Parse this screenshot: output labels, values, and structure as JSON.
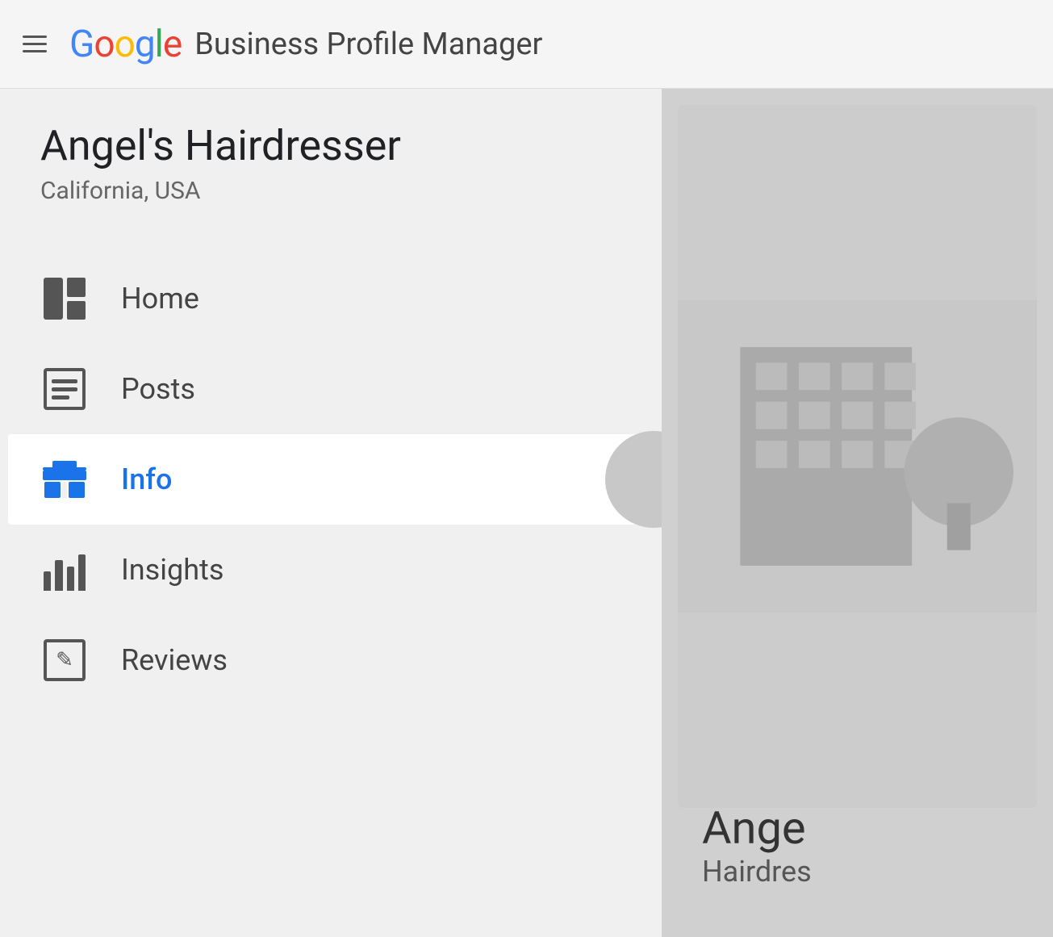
{
  "header": {
    "menu_label": "Menu",
    "google_letters": [
      "G",
      "o",
      "o",
      "g",
      "l",
      "e"
    ],
    "subtitle": "Business Profile Manager"
  },
  "sidebar": {
    "business_name": "Angel's Hairdresser",
    "business_location": "California, USA",
    "nav_items": [
      {
        "id": "home",
        "label": "Home",
        "icon": "home-icon",
        "active": false
      },
      {
        "id": "posts",
        "label": "Posts",
        "icon": "posts-icon",
        "active": false
      },
      {
        "id": "info",
        "label": "Info",
        "icon": "info-icon",
        "active": true
      },
      {
        "id": "insights",
        "label": "Insights",
        "icon": "insights-icon",
        "active": false
      },
      {
        "id": "reviews",
        "label": "Reviews",
        "icon": "reviews-icon",
        "active": false
      }
    ]
  },
  "right_panel": {
    "business_name": "Ange",
    "business_type": "Hairdres"
  },
  "colors": {
    "active_blue": "#1a73e8",
    "icon_default": "#555555",
    "bg_header": "#f5f5f5",
    "bg_sidebar": "#f0f0f0",
    "bg_active": "#ffffff",
    "bg_right": "#d0d0d0"
  }
}
